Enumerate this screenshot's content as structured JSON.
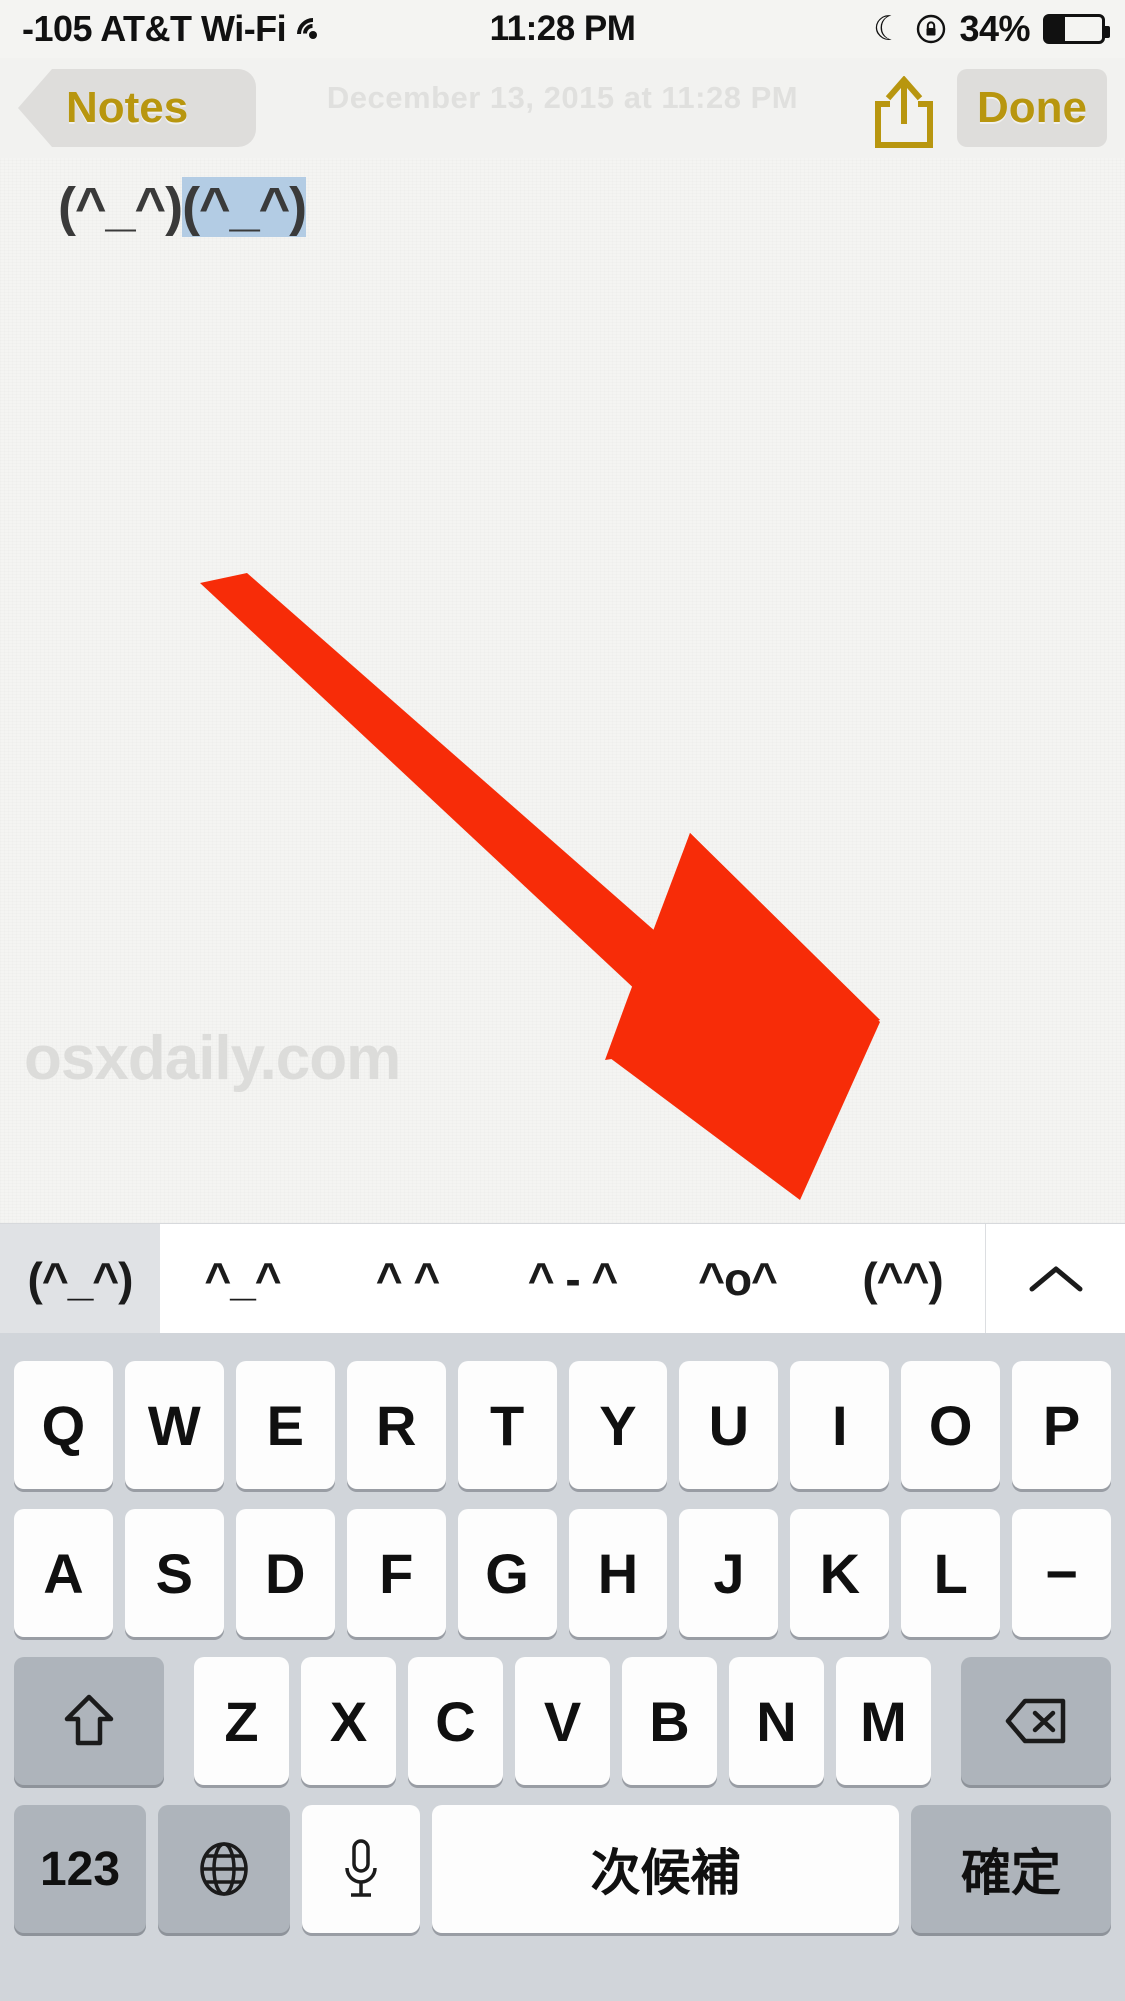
{
  "status_bar": {
    "signal_text": "-105 AT&T Wi-Fi",
    "wifi_icon": "wifi-icon",
    "time": "11:28 PM",
    "moon_icon": "do-not-disturb-moon-icon",
    "lock_icon": "rotation-lock-icon",
    "battery_percent": "34%",
    "battery_level": 34
  },
  "nav_bar": {
    "back_label": "Notes",
    "back_chevron_icon": "chevron-left-icon",
    "share_icon": "share-upload-icon",
    "done_label": "Done",
    "note_date": "December 13, 2015 at 11:28 PM",
    "accent_color": "#b8960f"
  },
  "note": {
    "text_plain": "(^_^)",
    "text_selected": "(^_^)",
    "selection_color": "#b3cce4",
    "watermark": "osxdaily.com",
    "add_button_icon": "plus-icon"
  },
  "predictive_bar": {
    "candidates": [
      "(^_^)",
      "^_^",
      "^ ^",
      "^ - ^",
      "^o^",
      "(^^)"
    ],
    "expand_icon": "chevron-up-icon"
  },
  "keyboard": {
    "row1": [
      "Q",
      "W",
      "E",
      "R",
      "T",
      "Y",
      "U",
      "I",
      "O",
      "P"
    ],
    "row2": [
      "A",
      "S",
      "D",
      "F",
      "G",
      "H",
      "J",
      "K",
      "L",
      "−"
    ],
    "row3_letters": [
      "Z",
      "X",
      "C",
      "V",
      "B",
      "N",
      "M"
    ],
    "shift_icon": "shift-up-arrow-icon",
    "delete_icon": "backspace-delete-icon",
    "numeric_label": "123",
    "globe_icon": "globe-language-icon",
    "mic_icon": "microphone-icon",
    "next_candidate_label": "次候補",
    "confirm_label": "確定"
  },
  "annotation": {
    "arrow_color": "#f72c08"
  }
}
